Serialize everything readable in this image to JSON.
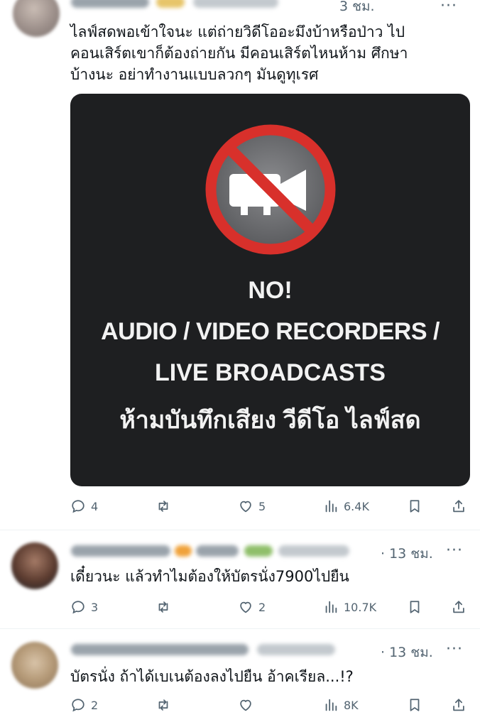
{
  "tweets": [
    {
      "time": "3 ชม.",
      "text": "ไลฟ์สดพอเข้าใจนะ แต่ถ่ายวิดีโออะมึงบ้าหรือป่าว ไป\nคอนเสิร์ตเขาก็ต้องถ่ายกัน มีคอนเสิร์ตไหนห้าม  ศึกษา\nบ้างนะ อย่าทำงานแบบลวกๆ มันดูทุเรศ",
      "sign": {
        "headline": "NO!",
        "line1": "AUDIO / VIDEO RECORDERS /",
        "line2": "LIVE BROADCASTS",
        "line3": "ห้ามบันทึกเสียง วีดีโอ ไลฟ์สด"
      },
      "replies": "4",
      "retweets": "",
      "likes": "5",
      "views": "6.4K"
    },
    {
      "time": "· 13 ชม.",
      "text": "เดี๋ยวนะ แล้วทำไมต้องให้บัตรนั่ง7900ไปยืน",
      "replies": "3",
      "retweets": "",
      "likes": "2",
      "views": "10.7K"
    },
    {
      "time": "· 13 ชม.",
      "text": "บัตรนั่ง ถ้าได้เบเนต้องลงไปยืน อ้าคเรียล...!?",
      "replies": "2",
      "retweets": "",
      "likes": "",
      "views": "8K"
    }
  ],
  "icons": {
    "reply": "reply-icon",
    "retweet": "retweet-icon",
    "like": "heart-icon",
    "views": "views-icon",
    "bookmark": "bookmark-icon",
    "share": "share-icon",
    "more": "more-icon",
    "sign_symbol": "no-video-camera-icon"
  },
  "colors": {
    "text": "#0f1419",
    "muted": "#536471",
    "divider": "#eff3f4",
    "media_bg": "#1e1f21",
    "prohibit_red": "#d8302b"
  }
}
